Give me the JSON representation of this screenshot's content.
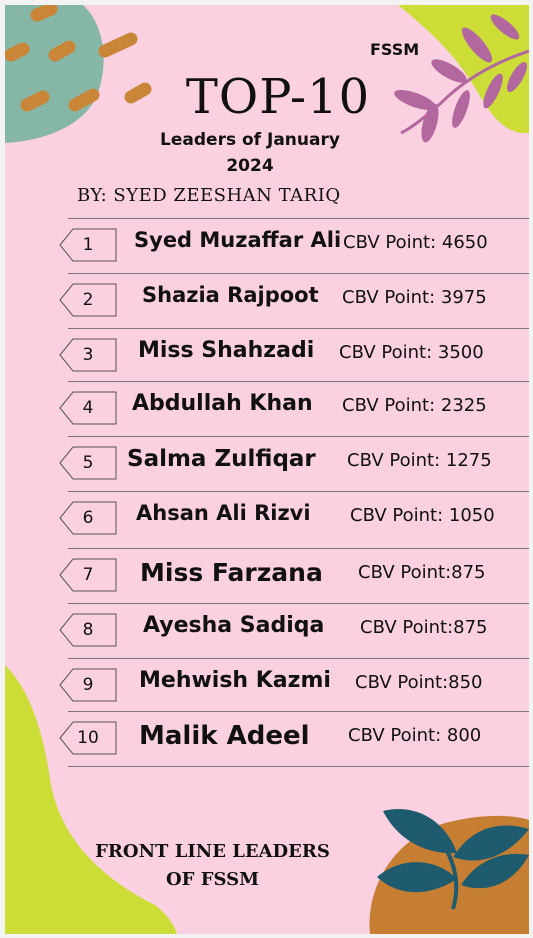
{
  "brand": "FSSM",
  "title": "TOP-10",
  "subtitle": "Leaders of January 2024",
  "byline": "BY: SYED ZEESHAN TARIQ",
  "footer": "FRONT LINE LEADERS OF FSSM",
  "colors": {
    "background": "#fbd0e0",
    "teal_blob": "#86b6a6",
    "orange_dash": "#c98639",
    "purple_leaf": "#b3679f",
    "lime_blob": "#cbdd36",
    "navy_leaf": "#1f5b6e",
    "orange_blob": "#c67e33"
  },
  "leaders": [
    {
      "rank": "1",
      "name": "Syed Muzaffar Ali",
      "points": "CBV Point: 4650"
    },
    {
      "rank": "2",
      "name": "Shazia Rajpoot",
      "points": "CBV Point: 3975"
    },
    {
      "rank": "3",
      "name": "Miss Shahzadi",
      "points": "CBV Point: 3500"
    },
    {
      "rank": "4",
      "name": "Abdullah Khan",
      "points": "CBV Point: 2325"
    },
    {
      "rank": "5",
      "name": "Salma Zulfiqar",
      "points": "CBV Point: 1275"
    },
    {
      "rank": "6",
      "name": "Ahsan Ali Rizvi",
      "points": "CBV Point: 1050"
    },
    {
      "rank": "7",
      "name": "Miss Farzana",
      "points": "CBV Point:875"
    },
    {
      "rank": "8",
      "name": "Ayesha Sadiqa",
      "points": "CBV Point:875"
    },
    {
      "rank": "9",
      "name": "Mehwish Kazmi",
      "points": "CBV Point:850"
    },
    {
      "rank": "10",
      "name": "Malik Adeel",
      "points": "CBV Point: 800"
    }
  ]
}
